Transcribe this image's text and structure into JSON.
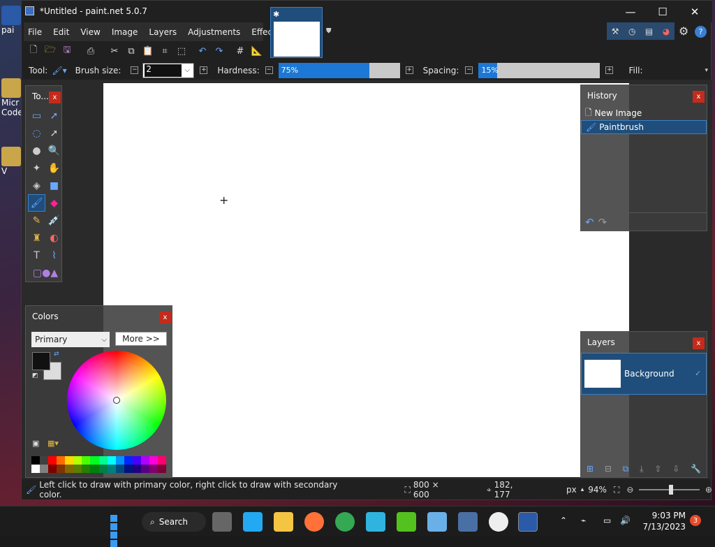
{
  "window": {
    "title": "*Untitled - paint.net 5.0.7",
    "controls": {
      "minimize": "—",
      "maximize": "☐",
      "close": "✕"
    }
  },
  "menu": [
    "File",
    "Edit",
    "View",
    "Image",
    "Layers",
    "Adjustments",
    "Effects"
  ],
  "options": {
    "tool_label": "Tool:",
    "brush_size_label": "Brush size:",
    "brush_size_value": "2",
    "hardness_label": "Hardness:",
    "hardness_value": "75%",
    "hardness_pct": 75,
    "spacing_label": "Spacing:",
    "spacing_value": "15%",
    "spacing_pct": 15,
    "fill_label": "Fill:"
  },
  "tools_panel": {
    "title": "To...",
    "close": "x"
  },
  "colors_panel": {
    "title": "Colors",
    "close": "x",
    "mode": "Primary",
    "more_label": "More >>",
    "primary_color": "#111111",
    "secondary_color": "#dddddd"
  },
  "history_panel": {
    "title": "History",
    "close": "x",
    "items": [
      "New Image",
      "Paintbrush"
    ]
  },
  "layers_panel": {
    "title": "Layers",
    "close": "x",
    "layers": [
      {
        "name": "Background",
        "checked": "✓"
      }
    ]
  },
  "status": {
    "hint": "Left click to draw with primary color, right click to draw with secondary color.",
    "size": "800 × 600",
    "cursor": "182, 177",
    "unit": "px",
    "zoom": "94%"
  },
  "desktop": {
    "icons": [
      {
        "label": "pai"
      },
      {
        "label": "Micr Code"
      },
      {
        "label": "V"
      }
    ]
  },
  "taskbar": {
    "search": "Search",
    "time": "9:03 PM",
    "date": "7/13/2023",
    "notifications": "3"
  },
  "palette": [
    "#000000",
    "#404040",
    "#ff0000",
    "#ff6a00",
    "#ffd800",
    "#b6ff00",
    "#4cff00",
    "#00ff21",
    "#00ff90",
    "#00ffff",
    "#0094ff",
    "#0026ff",
    "#4800ff",
    "#b200ff",
    "#ff00dc",
    "#ff006e"
  ],
  "palette_row2": [
    "#ffffff",
    "#808080",
    "#7f0000",
    "#7f3300",
    "#7f6a00",
    "#5b7f00",
    "#267f00",
    "#007f0e",
    "#007f46",
    "#007f7f",
    "#004a7f",
    "#00137f",
    "#21007f",
    "#57007f",
    "#7f006e",
    "#7f0037"
  ]
}
